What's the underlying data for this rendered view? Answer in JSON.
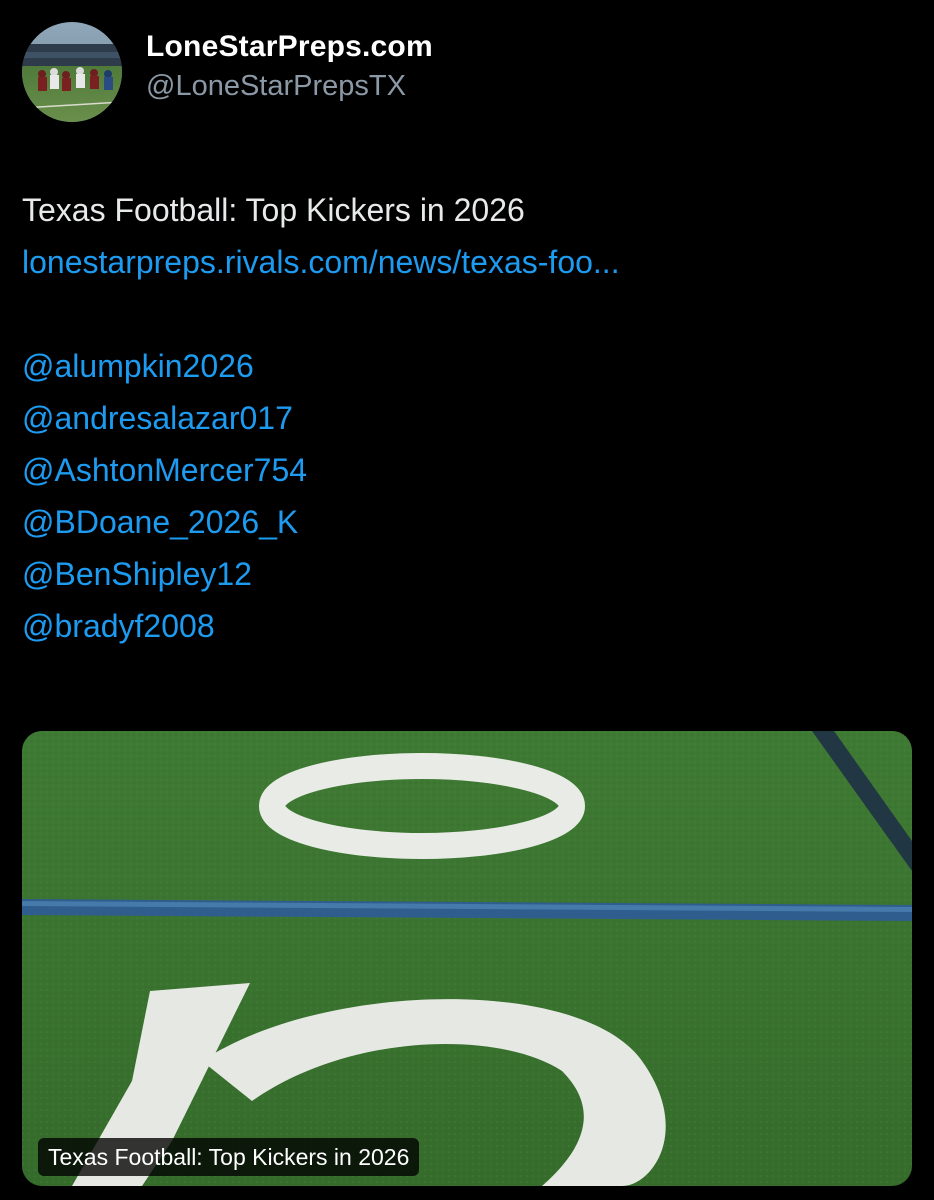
{
  "author": {
    "display_name": "LoneStarPreps.com",
    "handle": "@LoneStarPrepsTX",
    "avatar_icon": "football-game-avatar-photo"
  },
  "tweet": {
    "title": "Texas Football: Top Kickers in 2026",
    "link_text": "lonestarpreps.rivals.com/news/texas-foo...",
    "mentions": [
      "@alumpkin2026",
      "@andresalazar017",
      "@AshtonMercer754",
      "@BDoane_2026_K",
      "@BenShipley12",
      "@bradyf2008"
    ]
  },
  "card": {
    "image_icon": "football-field-50-yard-line-photo",
    "caption": "Texas Football: Top Kickers in 2026"
  },
  "colors": {
    "background": "#000000",
    "text": "#e7e9ea",
    "secondary_text": "#8b98a5",
    "link": "#1d9bf0"
  }
}
